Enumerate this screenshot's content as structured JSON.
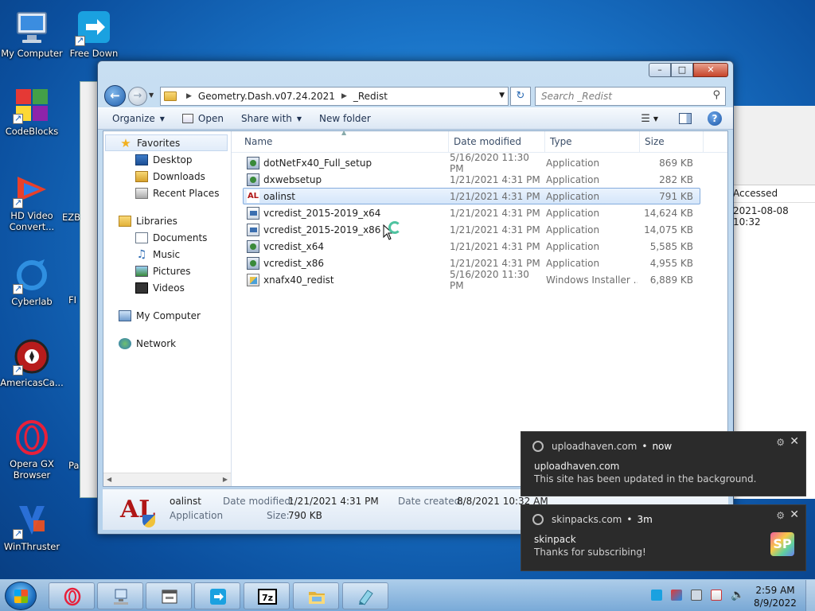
{
  "desktop": {
    "icons": [
      {
        "label": "My Computer"
      },
      {
        "label": "Free Down"
      },
      {
        "label": "CodeBlocks"
      },
      {
        "label": "HD Video Convert..."
      },
      {
        "label": "EZB"
      },
      {
        "label": "Cyberlab"
      },
      {
        "label": "FI"
      },
      {
        "label": "AmericasCa..."
      },
      {
        "label": "Opera GX Browser"
      },
      {
        "label": "Pa"
      },
      {
        "label": "WinThruster"
      }
    ]
  },
  "background_window": {
    "column_header": "Accessed",
    "value": "2021-08-08 10:32"
  },
  "explorer": {
    "address": {
      "crumbs": [
        "Geometry.Dash.v07.24.2021",
        "_Redist"
      ]
    },
    "search_placeholder": "Search _Redist",
    "commands": {
      "organize": "Organize",
      "open": "Open",
      "share_with": "Share with",
      "new_folder": "New folder"
    },
    "nav": {
      "favorites": "Favorites",
      "desktop": "Desktop",
      "downloads": "Downloads",
      "recent_places": "Recent Places",
      "libraries": "Libraries",
      "documents": "Documents",
      "music": "Music",
      "pictures": "Pictures",
      "videos": "Videos",
      "my_computer": "My Computer",
      "network": "Network"
    },
    "columns": {
      "name": "Name",
      "date": "Date modified",
      "type": "Type",
      "size": "Size"
    },
    "files": [
      {
        "name": "dotNetFx40_Full_setup",
        "date": "5/16/2020 11:30 PM",
        "type": "Application",
        "size": "869 KB"
      },
      {
        "name": "dxwebsetup",
        "date": "1/21/2021 4:31 PM",
        "type": "Application",
        "size": "282 KB"
      },
      {
        "name": "oalinst",
        "date": "1/21/2021 4:31 PM",
        "type": "Application",
        "size": "791 KB"
      },
      {
        "name": "vcredist_2015-2019_x64",
        "date": "1/21/2021 4:31 PM",
        "type": "Application",
        "size": "14,624 KB"
      },
      {
        "name": "vcredist_2015-2019_x86",
        "date": "1/21/2021 4:31 PM",
        "type": "Application",
        "size": "14,075 KB"
      },
      {
        "name": "vcredist_x64",
        "date": "1/21/2021 4:31 PM",
        "type": "Application",
        "size": "5,585 KB"
      },
      {
        "name": "vcredist_x86",
        "date": "1/21/2021 4:31 PM",
        "type": "Application",
        "size": "4,955 KB"
      },
      {
        "name": "xnafx40_redist",
        "date": "5/16/2020 11:30 PM",
        "type": "Windows Installer ...",
        "size": "6,889 KB"
      }
    ],
    "details": {
      "name": "oalinst",
      "kind": "Application",
      "modified_label": "Date modified:",
      "modified_value": "1/21/2021 4:31 PM",
      "created_label": "Date created:",
      "created_value": "8/8/2021 10:32 AM",
      "size_label": "Size:",
      "size_value": "790 KB"
    }
  },
  "notifications": [
    {
      "source": "uploadhaven.com",
      "time": "now",
      "title": "uploadhaven.com",
      "message": "This site has been updated in the background."
    },
    {
      "source": "skinpacks.com",
      "time": "3m",
      "title": "skinpack",
      "message": "Thanks for subscribing!",
      "badge": "SP"
    }
  ],
  "taskbar": {
    "time": "2:59 AM",
    "date": "8/9/2022"
  },
  "colors": {
    "accent": "#3399ff",
    "selection": "#d5e6fa",
    "toast_bg": "#2b2b2b"
  }
}
